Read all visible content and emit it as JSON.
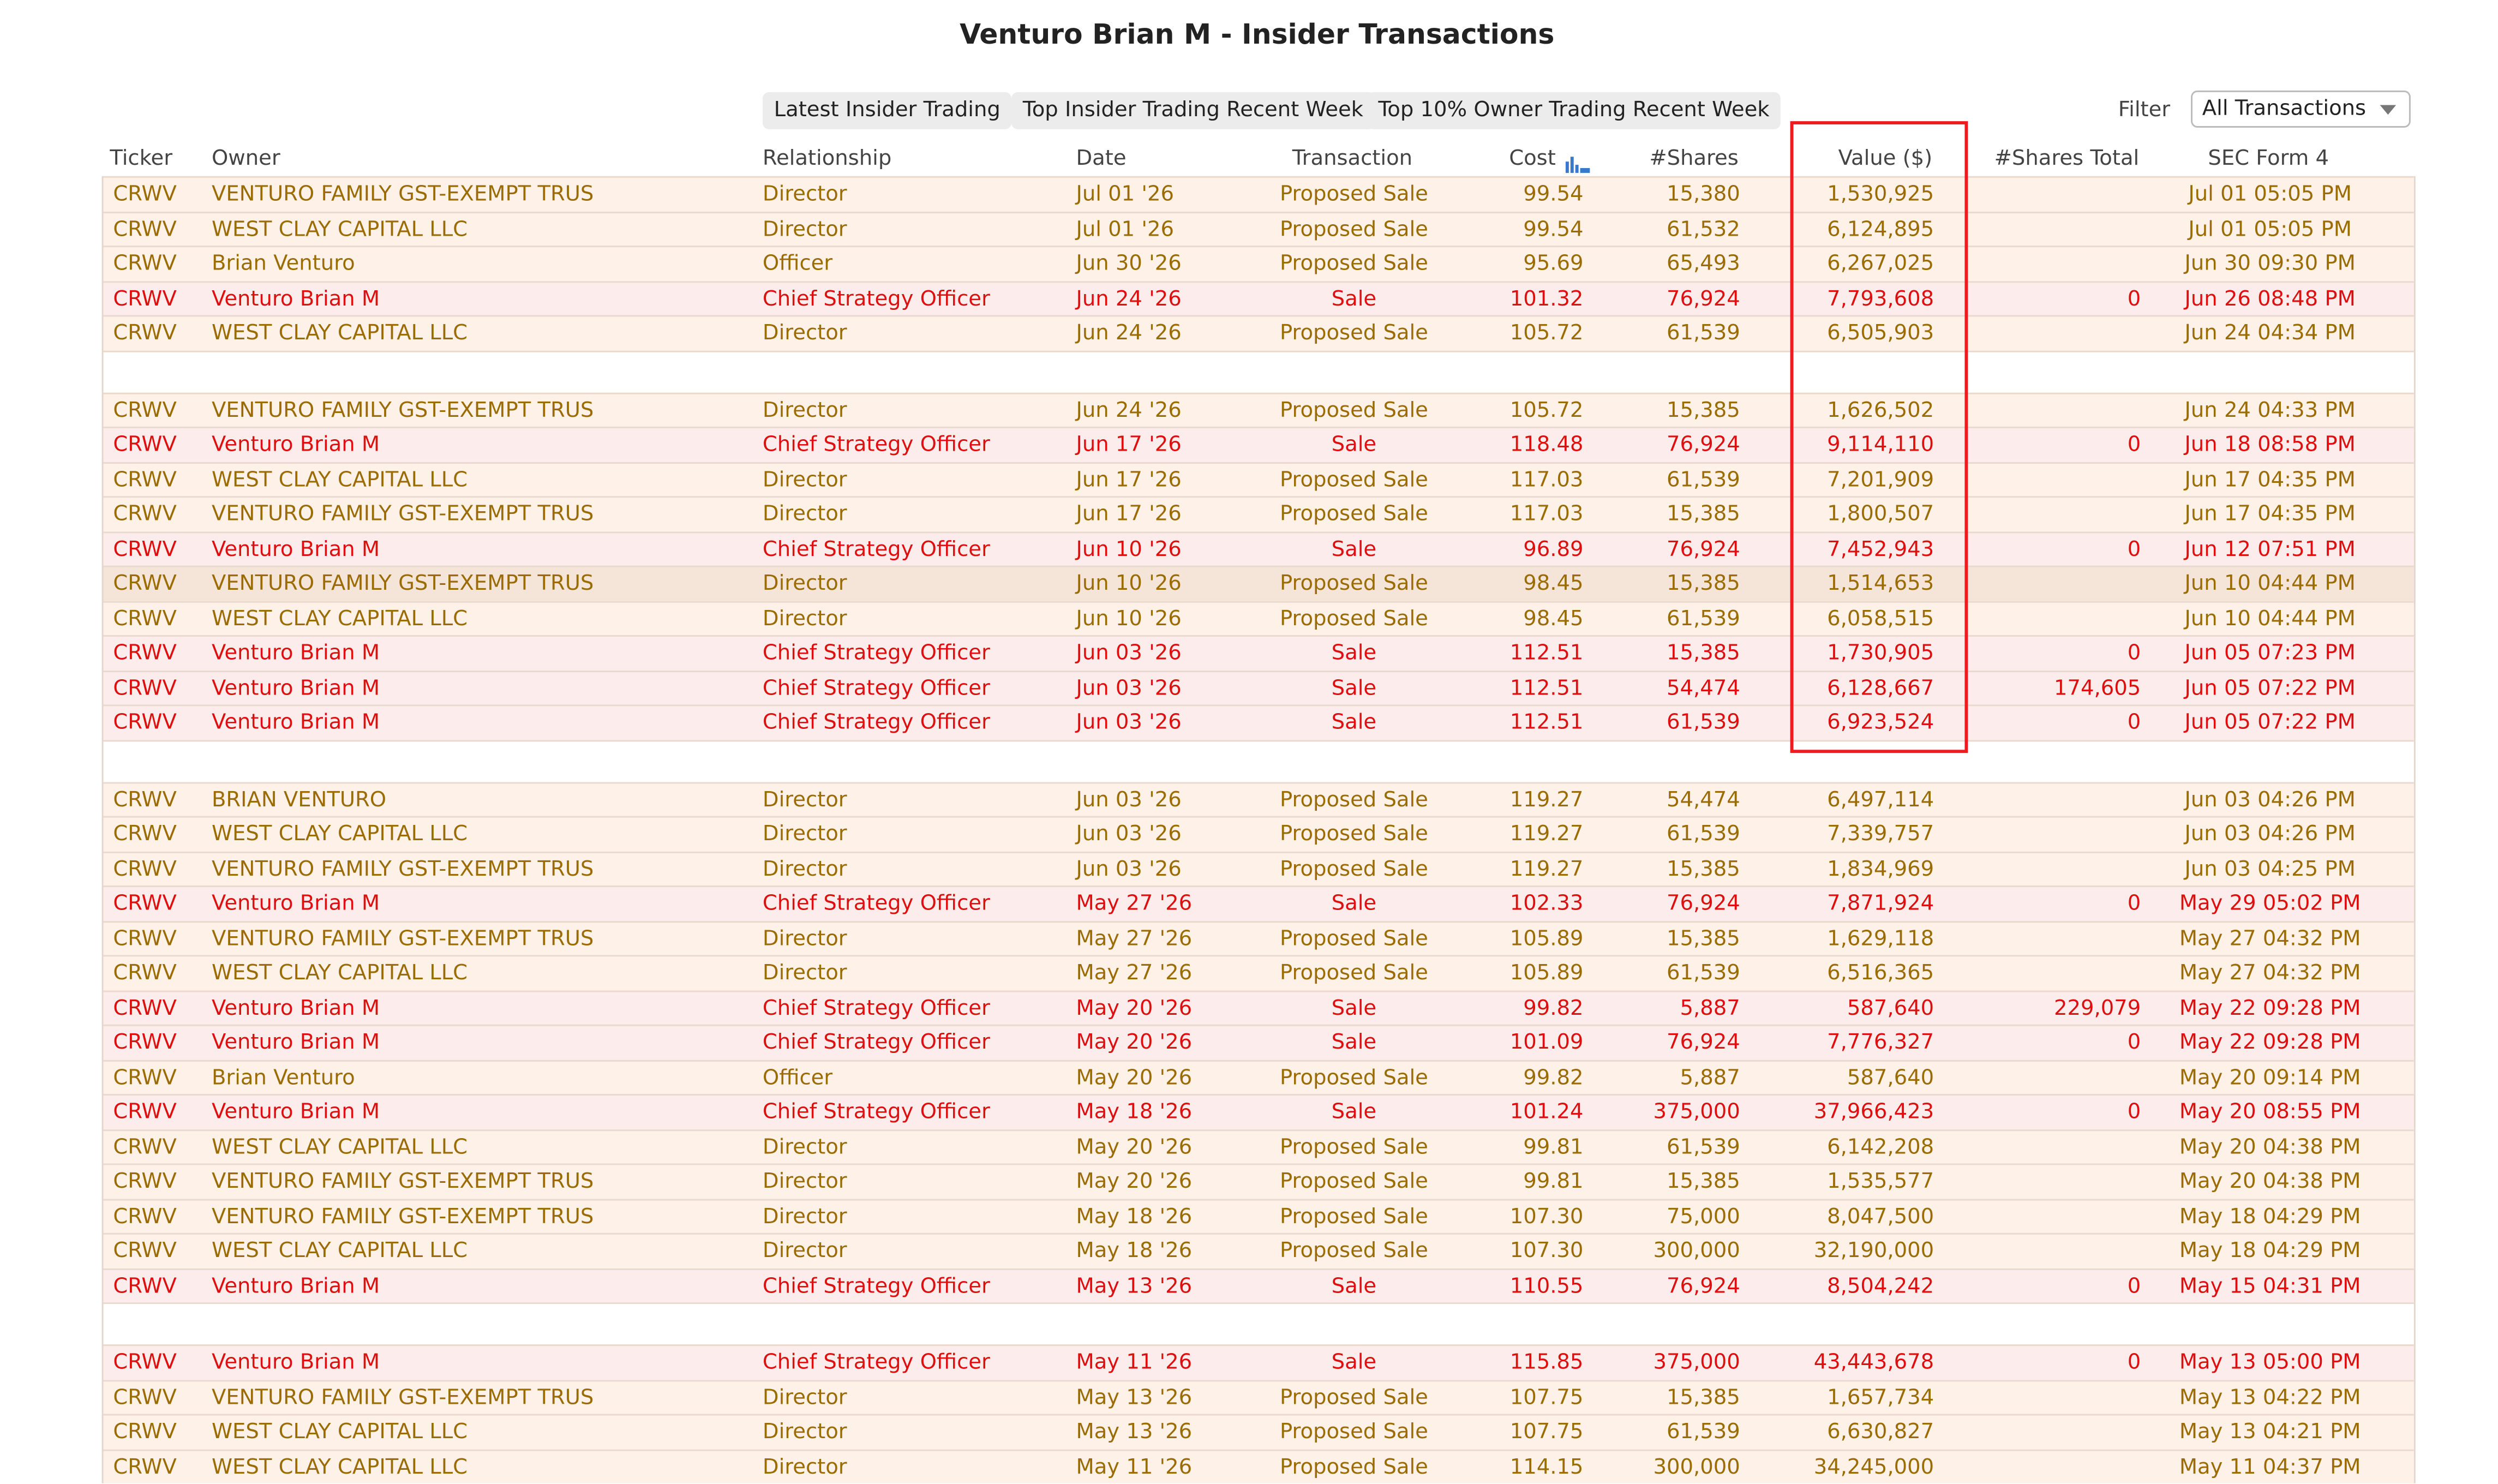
{
  "page_title": "Venturo Brian M - Insider Transactions",
  "toolbar": {
    "buttons": [
      "Latest Insider Trading",
      "Top Insider Trading Recent Week",
      "Top 10% Owner Trading Recent Week"
    ],
    "filter_label": "Filter",
    "filter_value": "All Transactions"
  },
  "columns": [
    "Ticker",
    "Owner",
    "Relationship",
    "Date",
    "Transaction",
    "Cost",
    "#Shares",
    "Value ($)",
    "#Shares Total",
    "SEC Form 4"
  ],
  "colors": {
    "proposed_text": "#9c6c04",
    "sale_text": "#dd0f0f",
    "highlight_box": "#ee1c1c",
    "sort_icon": "#3a78c9"
  },
  "rows": [
    {
      "ticker": "CRWV",
      "owner": "VENTURO FAMILY GST-EXEMPT TRUS",
      "relationship": "Director",
      "date": "Jul 01 '26",
      "transaction": "Proposed Sale",
      "cost": "99.54",
      "shares": "15,380",
      "value": "1,530,925",
      "shares_total": "",
      "sec": "Jul 01 05:05 PM"
    },
    {
      "ticker": "CRWV",
      "owner": "WEST CLAY CAPITAL LLC",
      "relationship": "Director",
      "date": "Jul 01 '26",
      "transaction": "Proposed Sale",
      "cost": "99.54",
      "shares": "61,532",
      "value": "6,124,895",
      "shares_total": "",
      "sec": "Jul 01 05:05 PM"
    },
    {
      "ticker": "CRWV",
      "owner": "Brian Venturo",
      "relationship": "Officer",
      "date": "Jun 30 '26",
      "transaction": "Proposed Sale",
      "cost": "95.69",
      "shares": "65,493",
      "value": "6,267,025",
      "shares_total": "",
      "sec": "Jun 30 09:30 PM"
    },
    {
      "ticker": "CRWV",
      "owner": "Venturo Brian M",
      "relationship": "Chief Strategy Officer",
      "date": "Jun 24 '26",
      "transaction": "Sale",
      "cost": "101.32",
      "shares": "76,924",
      "value": "7,793,608",
      "shares_total": "0",
      "sec": "Jun 26 08:48 PM"
    },
    {
      "ticker": "CRWV",
      "owner": "WEST CLAY CAPITAL LLC",
      "relationship": "Director",
      "date": "Jun 24 '26",
      "transaction": "Proposed Sale",
      "cost": "105.72",
      "shares": "61,539",
      "value": "6,505,903",
      "shares_total": "",
      "sec": "Jun 24 04:34 PM"
    },
    {
      "sep": true
    },
    {
      "ticker": "CRWV",
      "owner": "VENTURO FAMILY GST-EXEMPT TRUS",
      "relationship": "Director",
      "date": "Jun 24 '26",
      "transaction": "Proposed Sale",
      "cost": "105.72",
      "shares": "15,385",
      "value": "1,626,502",
      "shares_total": "",
      "sec": "Jun 24 04:33 PM"
    },
    {
      "ticker": "CRWV",
      "owner": "Venturo Brian M",
      "relationship": "Chief Strategy Officer",
      "date": "Jun 17 '26",
      "transaction": "Sale",
      "cost": "118.48",
      "shares": "76,924",
      "value": "9,114,110",
      "shares_total": "0",
      "sec": "Jun 18 08:58 PM"
    },
    {
      "ticker": "CRWV",
      "owner": "WEST CLAY CAPITAL LLC",
      "relationship": "Director",
      "date": "Jun 17 '26",
      "transaction": "Proposed Sale",
      "cost": "117.03",
      "shares": "61,539",
      "value": "7,201,909",
      "shares_total": "",
      "sec": "Jun 17 04:35 PM"
    },
    {
      "ticker": "CRWV",
      "owner": "VENTURO FAMILY GST-EXEMPT TRUS",
      "relationship": "Director",
      "date": "Jun 17 '26",
      "transaction": "Proposed Sale",
      "cost": "117.03",
      "shares": "15,385",
      "value": "1,800,507",
      "shares_total": "",
      "sec": "Jun 17 04:35 PM"
    },
    {
      "ticker": "CRWV",
      "owner": "Venturo Brian M",
      "relationship": "Chief Strategy Officer",
      "date": "Jun 10 '26",
      "transaction": "Sale",
      "cost": "96.89",
      "shares": "76,924",
      "value": "7,452,943",
      "shares_total": "0",
      "sec": "Jun 12 07:51 PM"
    },
    {
      "ticker": "CRWV",
      "owner": "VENTURO FAMILY GST-EXEMPT TRUS",
      "relationship": "Director",
      "date": "Jun 10 '26",
      "transaction": "Proposed Sale",
      "cost": "98.45",
      "shares": "15,385",
      "value": "1,514,653",
      "shares_total": "",
      "sec": "Jun 10 04:44 PM",
      "highlight": true
    },
    {
      "ticker": "CRWV",
      "owner": "WEST CLAY CAPITAL LLC",
      "relationship": "Director",
      "date": "Jun 10 '26",
      "transaction": "Proposed Sale",
      "cost": "98.45",
      "shares": "61,539",
      "value": "6,058,515",
      "shares_total": "",
      "sec": "Jun 10 04:44 PM"
    },
    {
      "ticker": "CRWV",
      "owner": "Venturo Brian M",
      "relationship": "Chief Strategy Officer",
      "date": "Jun 03 '26",
      "transaction": "Sale",
      "cost": "112.51",
      "shares": "15,385",
      "value": "1,730,905",
      "shares_total": "0",
      "sec": "Jun 05 07:23 PM"
    },
    {
      "ticker": "CRWV",
      "owner": "Venturo Brian M",
      "relationship": "Chief Strategy Officer",
      "date": "Jun 03 '26",
      "transaction": "Sale",
      "cost": "112.51",
      "shares": "54,474",
      "value": "6,128,667",
      "shares_total": "174,605",
      "sec": "Jun 05 07:22 PM"
    },
    {
      "ticker": "CRWV",
      "owner": "Venturo Brian M",
      "relationship": "Chief Strategy Officer",
      "date": "Jun 03 '26",
      "transaction": "Sale",
      "cost": "112.51",
      "shares": "61,539",
      "value": "6,923,524",
      "shares_total": "0",
      "sec": "Jun 05 07:22 PM"
    },
    {
      "sep": true
    },
    {
      "ticker": "CRWV",
      "owner": "BRIAN VENTURO",
      "relationship": "Director",
      "date": "Jun 03 '26",
      "transaction": "Proposed Sale",
      "cost": "119.27",
      "shares": "54,474",
      "value": "6,497,114",
      "shares_total": "",
      "sec": "Jun 03 04:26 PM"
    },
    {
      "ticker": "CRWV",
      "owner": "WEST CLAY CAPITAL LLC",
      "relationship": "Director",
      "date": "Jun 03 '26",
      "transaction": "Proposed Sale",
      "cost": "119.27",
      "shares": "61,539",
      "value": "7,339,757",
      "shares_total": "",
      "sec": "Jun 03 04:26 PM"
    },
    {
      "ticker": "CRWV",
      "owner": "VENTURO FAMILY GST-EXEMPT TRUS",
      "relationship": "Director",
      "date": "Jun 03 '26",
      "transaction": "Proposed Sale",
      "cost": "119.27",
      "shares": "15,385",
      "value": "1,834,969",
      "shares_total": "",
      "sec": "Jun 03 04:25 PM"
    },
    {
      "ticker": "CRWV",
      "owner": "Venturo Brian M",
      "relationship": "Chief Strategy Officer",
      "date": "May 27 '26",
      "transaction": "Sale",
      "cost": "102.33",
      "shares": "76,924",
      "value": "7,871,924",
      "shares_total": "0",
      "sec": "May 29 05:02 PM"
    },
    {
      "ticker": "CRWV",
      "owner": "VENTURO FAMILY GST-EXEMPT TRUS",
      "relationship": "Director",
      "date": "May 27 '26",
      "transaction": "Proposed Sale",
      "cost": "105.89",
      "shares": "15,385",
      "value": "1,629,118",
      "shares_total": "",
      "sec": "May 27 04:32 PM"
    },
    {
      "ticker": "CRWV",
      "owner": "WEST CLAY CAPITAL LLC",
      "relationship": "Director",
      "date": "May 27 '26",
      "transaction": "Proposed Sale",
      "cost": "105.89",
      "shares": "61,539",
      "value": "6,516,365",
      "shares_total": "",
      "sec": "May 27 04:32 PM"
    },
    {
      "ticker": "CRWV",
      "owner": "Venturo Brian M",
      "relationship": "Chief Strategy Officer",
      "date": "May 20 '26",
      "transaction": "Sale",
      "cost": "99.82",
      "shares": "5,887",
      "value": "587,640",
      "shares_total": "229,079",
      "sec": "May 22 09:28 PM"
    },
    {
      "ticker": "CRWV",
      "owner": "Venturo Brian M",
      "relationship": "Chief Strategy Officer",
      "date": "May 20 '26",
      "transaction": "Sale",
      "cost": "101.09",
      "shares": "76,924",
      "value": "7,776,327",
      "shares_total": "0",
      "sec": "May 22 09:28 PM"
    },
    {
      "ticker": "CRWV",
      "owner": "Brian Venturo",
      "relationship": "Officer",
      "date": "May 20 '26",
      "transaction": "Proposed Sale",
      "cost": "99.82",
      "shares": "5,887",
      "value": "587,640",
      "shares_total": "",
      "sec": "May 20 09:14 PM"
    },
    {
      "ticker": "CRWV",
      "owner": "Venturo Brian M",
      "relationship": "Chief Strategy Officer",
      "date": "May 18 '26",
      "transaction": "Sale",
      "cost": "101.24",
      "shares": "375,000",
      "value": "37,966,423",
      "shares_total": "0",
      "sec": "May 20 08:55 PM"
    },
    {
      "ticker": "CRWV",
      "owner": "WEST CLAY CAPITAL LLC",
      "relationship": "Director",
      "date": "May 20 '26",
      "transaction": "Proposed Sale",
      "cost": "99.81",
      "shares": "61,539",
      "value": "6,142,208",
      "shares_total": "",
      "sec": "May 20 04:38 PM"
    },
    {
      "ticker": "CRWV",
      "owner": "VENTURO FAMILY GST-EXEMPT TRUS",
      "relationship": "Director",
      "date": "May 20 '26",
      "transaction": "Proposed Sale",
      "cost": "99.81",
      "shares": "15,385",
      "value": "1,535,577",
      "shares_total": "",
      "sec": "May 20 04:38 PM"
    },
    {
      "ticker": "CRWV",
      "owner": "VENTURO FAMILY GST-EXEMPT TRUS",
      "relationship": "Director",
      "date": "May 18 '26",
      "transaction": "Proposed Sale",
      "cost": "107.30",
      "shares": "75,000",
      "value": "8,047,500",
      "shares_total": "",
      "sec": "May 18 04:29 PM"
    },
    {
      "ticker": "CRWV",
      "owner": "WEST CLAY CAPITAL LLC",
      "relationship": "Director",
      "date": "May 18 '26",
      "transaction": "Proposed Sale",
      "cost": "107.30",
      "shares": "300,000",
      "value": "32,190,000",
      "shares_total": "",
      "sec": "May 18 04:29 PM"
    },
    {
      "ticker": "CRWV",
      "owner": "Venturo Brian M",
      "relationship": "Chief Strategy Officer",
      "date": "May 13 '26",
      "transaction": "Sale",
      "cost": "110.55",
      "shares": "76,924",
      "value": "8,504,242",
      "shares_total": "0",
      "sec": "May 15 04:31 PM"
    },
    {
      "sep": true
    },
    {
      "ticker": "CRWV",
      "owner": "Venturo Brian M",
      "relationship": "Chief Strategy Officer",
      "date": "May 11 '26",
      "transaction": "Sale",
      "cost": "115.85",
      "shares": "375,000",
      "value": "43,443,678",
      "shares_total": "0",
      "sec": "May 13 05:00 PM"
    },
    {
      "ticker": "CRWV",
      "owner": "VENTURO FAMILY GST-EXEMPT TRUS",
      "relationship": "Director",
      "date": "May 13 '26",
      "transaction": "Proposed Sale",
      "cost": "107.75",
      "shares": "15,385",
      "value": "1,657,734",
      "shares_total": "",
      "sec": "May 13 04:22 PM"
    },
    {
      "ticker": "CRWV",
      "owner": "WEST CLAY CAPITAL LLC",
      "relationship": "Director",
      "date": "May 13 '26",
      "transaction": "Proposed Sale",
      "cost": "107.75",
      "shares": "61,539",
      "value": "6,630,827",
      "shares_total": "",
      "sec": "May 13 04:21 PM"
    },
    {
      "ticker": "CRWV",
      "owner": "WEST CLAY CAPITAL LLC",
      "relationship": "Director",
      "date": "May 11 '26",
      "transaction": "Proposed Sale",
      "cost": "114.15",
      "shares": "300,000",
      "value": "34,245,000",
      "shares_total": "",
      "sec": "May 11 04:37 PM"
    }
  ]
}
